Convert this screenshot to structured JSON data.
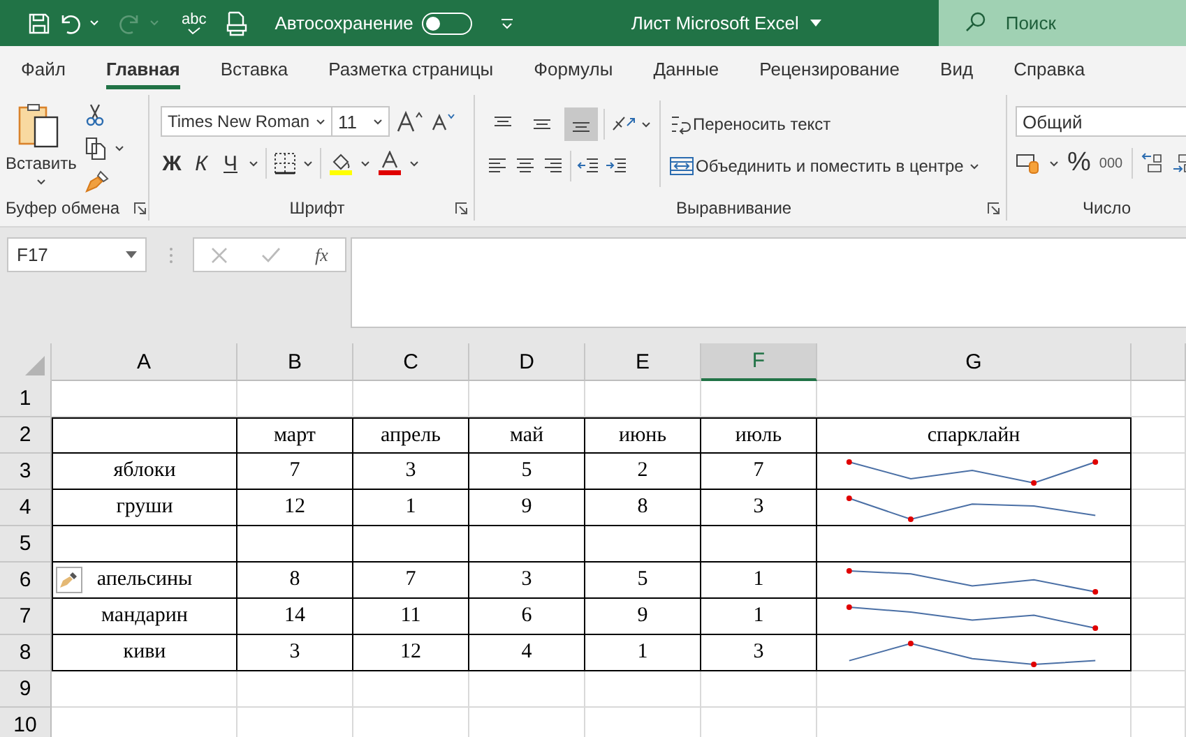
{
  "title_bar": {
    "spelling_label": "abc",
    "autosave_label": "Автосохранение",
    "autosave_on": false,
    "document_title": "Лист Microsoft Excel",
    "search_placeholder": "Поиск"
  },
  "tabs": [
    {
      "label": "Файл",
      "selected": false
    },
    {
      "label": "Главная",
      "selected": true
    },
    {
      "label": "Вставка",
      "selected": false
    },
    {
      "label": "Разметка страницы",
      "selected": false
    },
    {
      "label": "Формулы",
      "selected": false
    },
    {
      "label": "Данные",
      "selected": false
    },
    {
      "label": "Рецензирование",
      "selected": false
    },
    {
      "label": "Вид",
      "selected": false
    },
    {
      "label": "Справка",
      "selected": false
    }
  ],
  "ribbon": {
    "clipboard": {
      "paste_label": "Вставить",
      "group_label": "Буфер обмена"
    },
    "font": {
      "font_name": "Times New Roman",
      "font_size": "11",
      "bold_label": "Ж",
      "italic_label": "К",
      "underline_label": "Ч",
      "group_label": "Шрифт"
    },
    "alignment": {
      "vertical_align_buttons": [
        {
          "selected": false
        },
        {
          "selected": false
        },
        {
          "selected": true
        }
      ],
      "wrap_label": "Переносить текст",
      "merge_label": "Объединить и поместить в центре",
      "group_label": "Выравнивание"
    },
    "number": {
      "format": "Общий",
      "percent_label": "%",
      "thousands_label": "000",
      "group_label": "Число"
    }
  },
  "formula_bar": {
    "name_box": "F17",
    "fx_label": "fx"
  },
  "sheet": {
    "columns": [
      {
        "label": "A",
        "selected": false
      },
      {
        "label": "B",
        "selected": false
      },
      {
        "label": "C",
        "selected": false
      },
      {
        "label": "D",
        "selected": false
      },
      {
        "label": "E",
        "selected": false
      },
      {
        "label": "F",
        "selected": true
      },
      {
        "label": "G",
        "selected": false
      }
    ],
    "rows": [
      {
        "number": "1",
        "kind": "empty"
      },
      {
        "number": "2",
        "kind": "header",
        "labels": [
          "март",
          "апрель",
          "май",
          "июнь",
          "июль",
          "спарклайн"
        ]
      },
      {
        "number": "3",
        "kind": "data",
        "name": "яблоки",
        "values": [
          "7",
          "3",
          "5",
          "2",
          "7"
        ],
        "paste_options": false
      },
      {
        "number": "4",
        "kind": "data",
        "name": "груши",
        "values": [
          "12",
          "1",
          "9",
          "8",
          "3"
        ],
        "paste_options": false
      },
      {
        "number": "5",
        "kind": "blank"
      },
      {
        "number": "6",
        "kind": "data",
        "name": "апельсины",
        "values": [
          "8",
          "7",
          "3",
          "5",
          "1"
        ],
        "paste_options": true
      },
      {
        "number": "7",
        "kind": "data",
        "name": "мандарин",
        "values": [
          "14",
          "11",
          "6",
          "9",
          "1"
        ],
        "paste_options": false
      },
      {
        "number": "8",
        "kind": "data",
        "name": "киви",
        "values": [
          "3",
          "12",
          "4",
          "1",
          "3"
        ],
        "paste_options": false
      },
      {
        "number": "9",
        "kind": "empty"
      },
      {
        "number": "10",
        "kind": "empty"
      }
    ]
  }
}
